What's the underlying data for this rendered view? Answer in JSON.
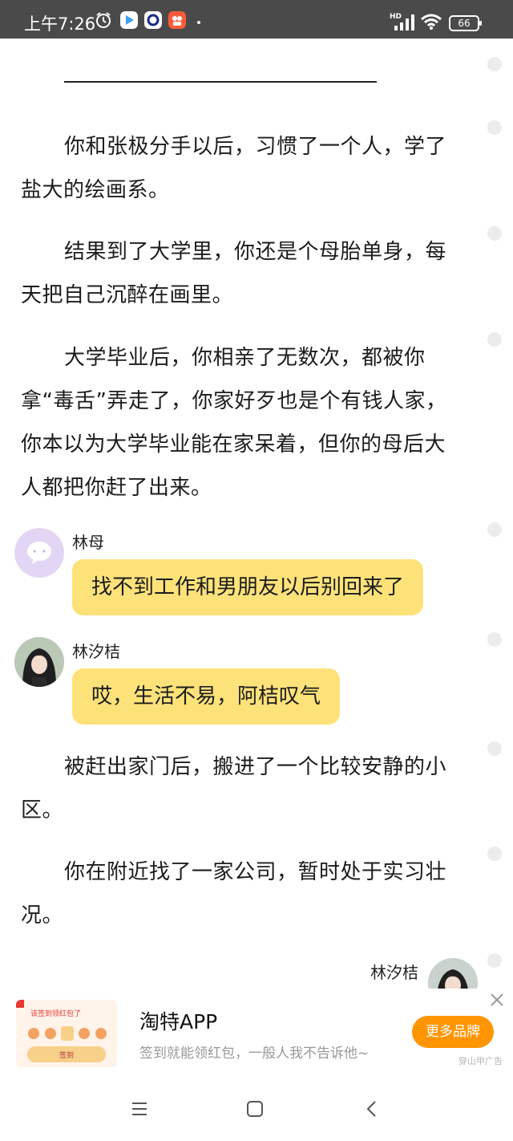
{
  "status_bar": {
    "time": "上午7:26",
    "network_tag": "HD",
    "battery": "66"
  },
  "story": {
    "paragraphs": [
      "你和张极分手以后，习惯了一个人，学了盐大的绘画系。",
      "结果到了大学里，你还是个母胎单身，每天把自己沉醉在画里。",
      "大学毕业后，你相亲了无数次，都被你拿“毒舌”弄走了，你家好歹也是个有钱人家，你本以为大学毕业能在家呆着，但你的母后大人都把你赶了出来。",
      "被赶出家门后，搬进了一个比较安静的小区。",
      "你在附近找了一家公司，暂时处于实习壮况。"
    ],
    "messages": [
      {
        "speaker": "林母",
        "text": "找不到工作和男朋友以后别回来了"
      },
      {
        "speaker": "林汐桔",
        "text": "哎，生活不易，阿桔叹气"
      }
    ],
    "partial_speaker": "林汐桔"
  },
  "ad": {
    "title": "淘特APP",
    "description": "签到就能领红包，一般人我不告诉他~",
    "cta": "更多品牌",
    "tag": "穿山甲广告",
    "thumb_headline": "该签到领红包了",
    "thumb_button": "签到"
  },
  "colors": {
    "status_bar_bg": "#4a4a4a",
    "bubble": "#fde27a",
    "ad_button": "#ff9500"
  }
}
